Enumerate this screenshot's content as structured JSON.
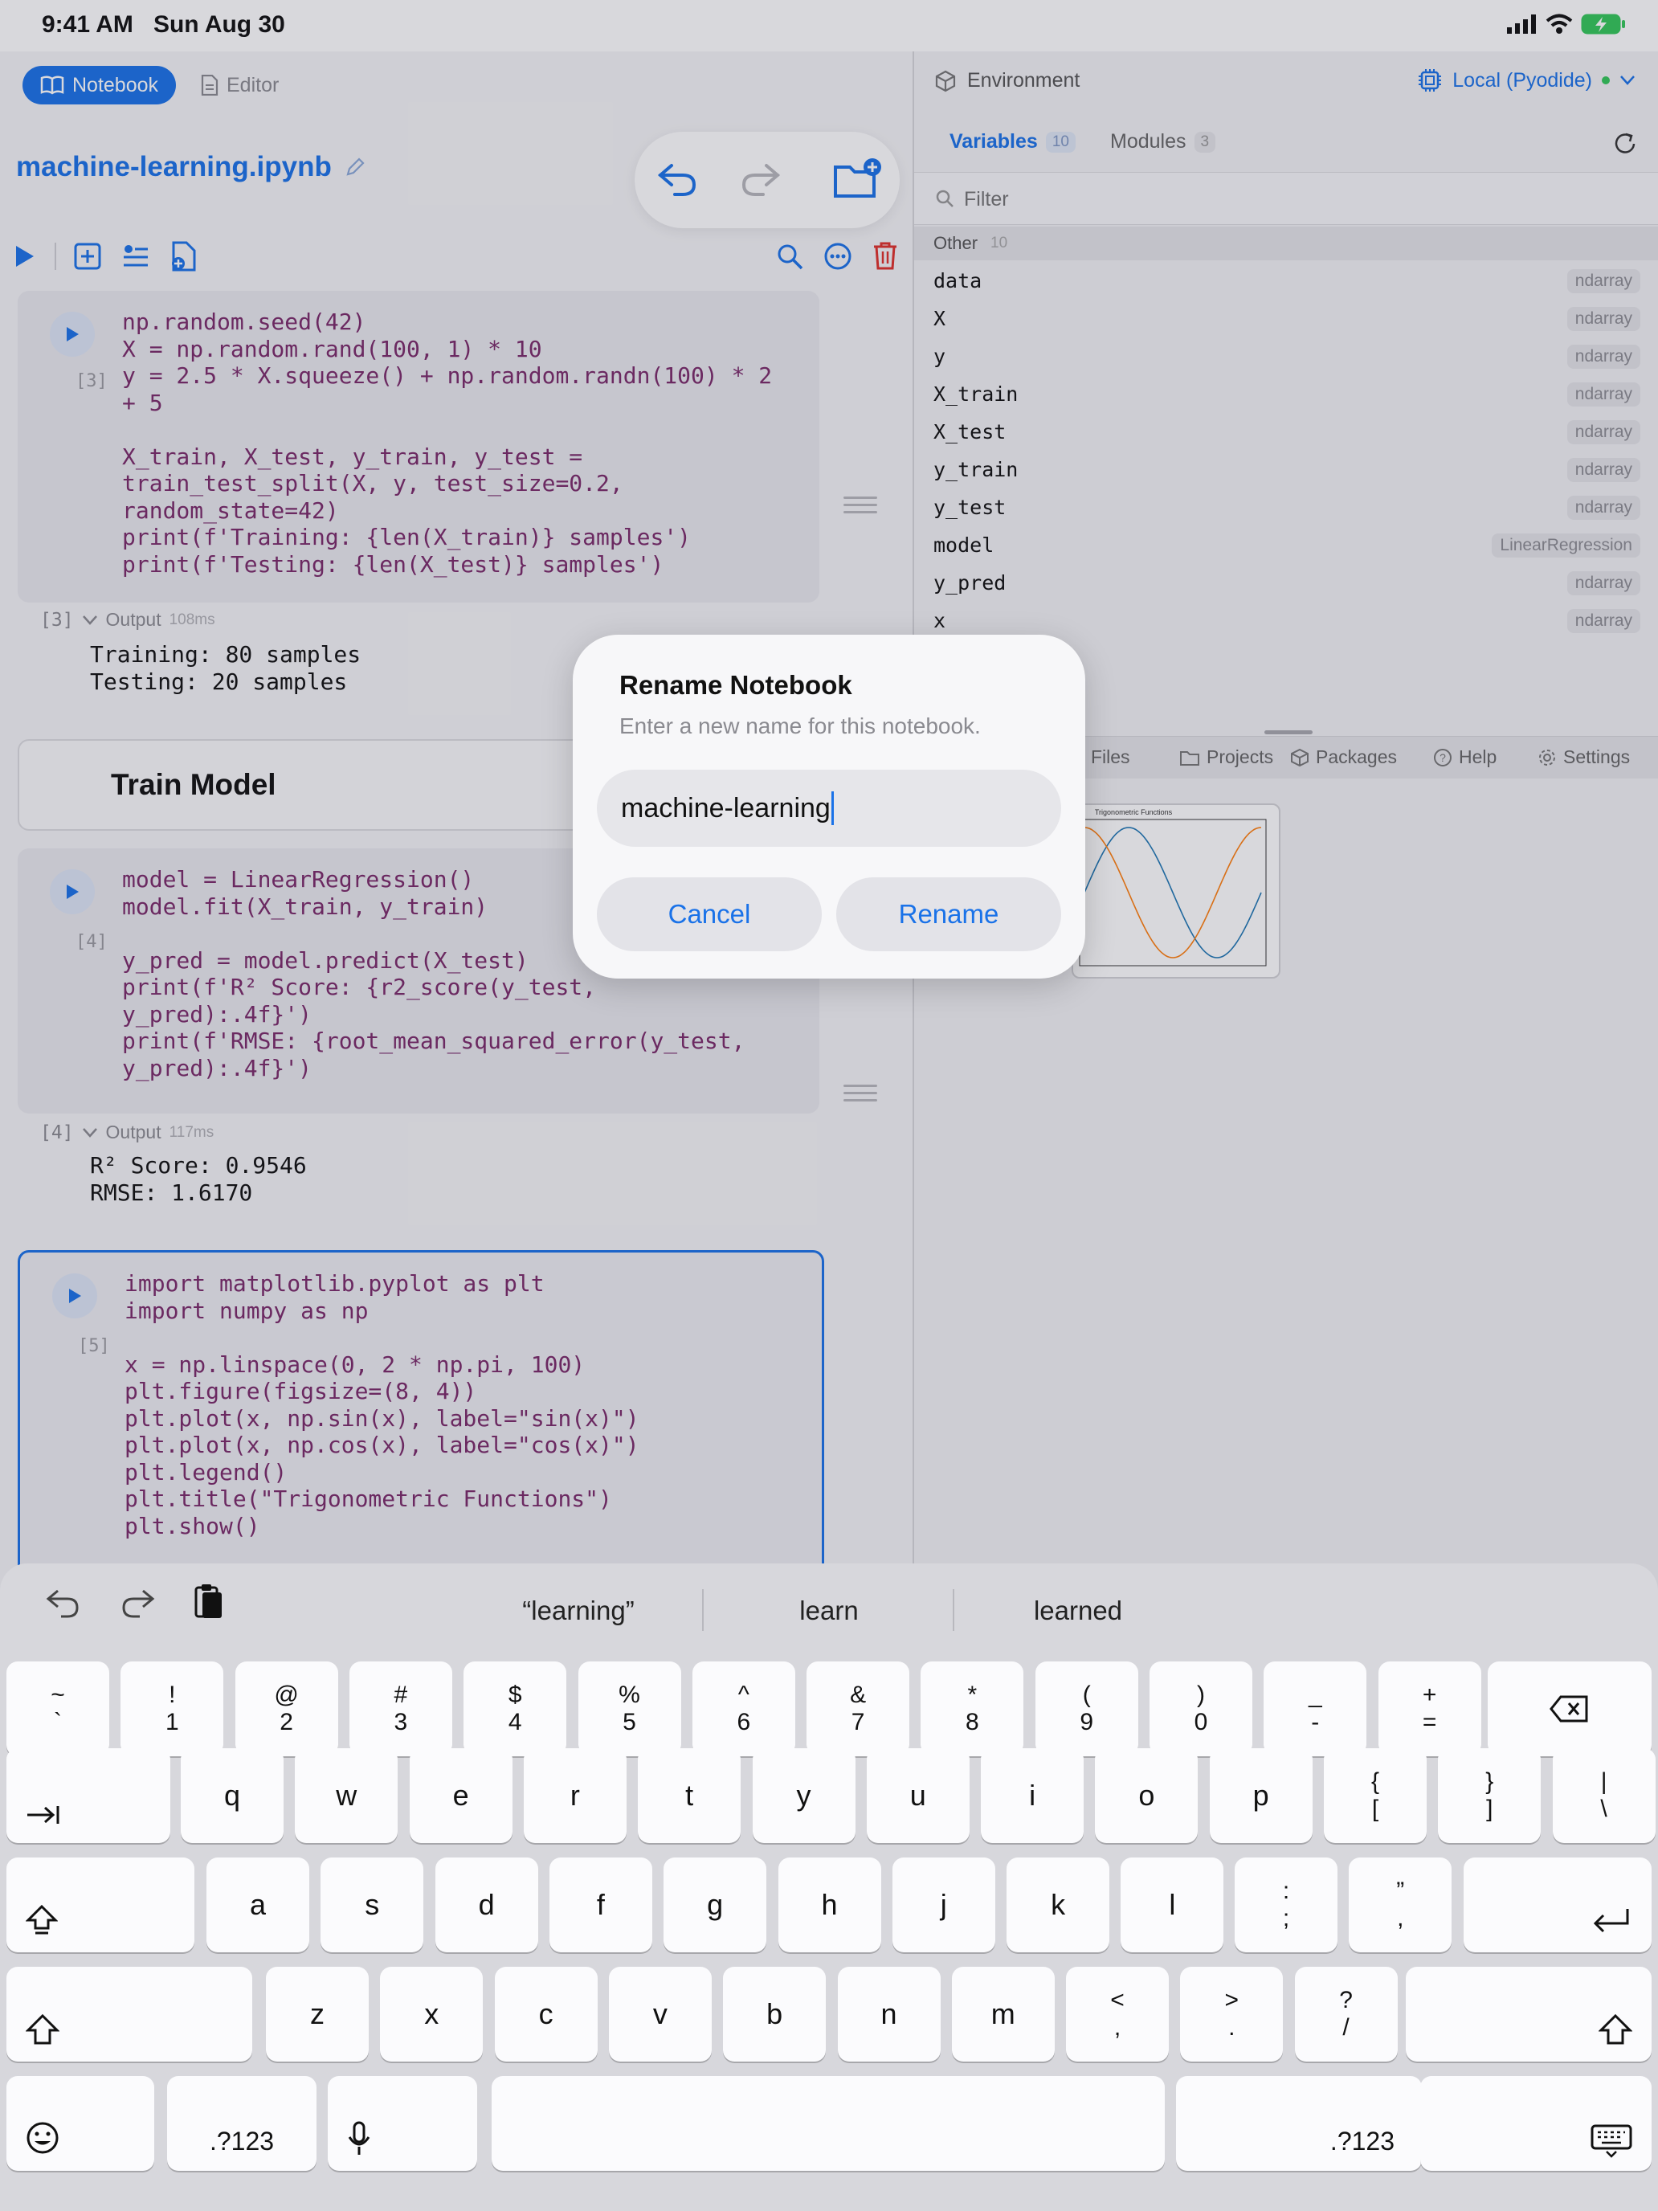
{
  "status_bar": {
    "time": "9:41 AM",
    "date": "Sun Aug 30"
  },
  "toolbar": {
    "notebook_tab": "Notebook",
    "editor_tab": "Editor",
    "filename": "machine-learning.ipynb"
  },
  "cells": [
    {
      "exec_label": "[3]",
      "code": "np.random.seed(42)\nX = np.random.rand(100, 1) * 10\ny = 2.5 * X.squeeze() + np.random.randn(100) * 2\n+ 5\n\nX_train, X_test, y_train, y_test =\ntrain_test_split(X, y, test_size=0.2,\nrandom_state=42)\nprint(f'Training: {len(X_train)} samples')\nprint(f'Testing: {len(X_test)} samples')",
      "output_label": "[3]",
      "output_title": "Output",
      "output_time": "108ms",
      "output": "Training: 80 samples\nTesting: 20 samples"
    },
    {
      "exec_label": "[4]",
      "code": "model = LinearRegression()\nmodel.fit(X_train, y_train)\n\ny_pred = model.predict(X_test)\nprint(f'R² Score: {r2_score(y_test,\ny_pred):.4f}')\nprint(f'RMSE: {root_mean_squared_error(y_test,\ny_pred):.4f}')",
      "output_label": "[4]",
      "output_title": "Output",
      "output_time": "117ms",
      "output": "R² Score: 0.9546\nRMSE: 1.6170"
    },
    {
      "exec_label": "[5]",
      "code": "import matplotlib.pyplot as plt\nimport numpy as np\n\nx = np.linspace(0, 2 * np.pi, 100)\nplt.figure(figsize=(8, 4))\nplt.plot(x, np.sin(x), label=\"sin(x)\")\nplt.plot(x, np.cos(x), label=\"cos(x)\")\nplt.legend()\nplt.title(\"Trigonometric Functions\")\nplt.show()"
    }
  ],
  "markdown_heading": "Train Model",
  "environment": {
    "title": "Environment",
    "runtime": "Local (Pyodide)",
    "tabs": {
      "variables": "Variables",
      "variables_count": "10",
      "modules": "Modules",
      "modules_count": "3"
    },
    "filter_placeholder": "Filter",
    "group_label": "Other",
    "group_count": "10",
    "variables": [
      {
        "name": "data",
        "type": "ndarray"
      },
      {
        "name": "X",
        "type": "ndarray"
      },
      {
        "name": "y",
        "type": "ndarray"
      },
      {
        "name": "X_train",
        "type": "ndarray"
      },
      {
        "name": "X_test",
        "type": "ndarray"
      },
      {
        "name": "y_train",
        "type": "ndarray"
      },
      {
        "name": "y_test",
        "type": "ndarray"
      },
      {
        "name": "model",
        "type": "LinearRegression"
      },
      {
        "name": "y_pred",
        "type": "ndarray"
      },
      {
        "name": "x",
        "type": "ndarray"
      }
    ],
    "bottom_tabs": {
      "files": "Files",
      "projects": "Projects",
      "packages": "Packages",
      "help": "Help",
      "settings": "Settings"
    },
    "plot_title": "Trigonometric Functions"
  },
  "dialog": {
    "title": "Rename Notebook",
    "message": "Enter a new name for this notebook.",
    "input_value": "machine-learning",
    "cancel": "Cancel",
    "confirm": "Rename"
  },
  "keyboard": {
    "suggestions": [
      "“learning”",
      "learn",
      "learned"
    ],
    "row1": [
      [
        "~",
        "`"
      ],
      [
        "!",
        "1"
      ],
      [
        "@",
        "2"
      ],
      [
        "#",
        "3"
      ],
      [
        "$",
        "4"
      ],
      [
        "%",
        "5"
      ],
      [
        "^",
        "6"
      ],
      [
        "&",
        "7"
      ],
      [
        "*",
        "8"
      ],
      [
        "(",
        "9"
      ],
      [
        ")",
        "0"
      ],
      [
        "_",
        "-"
      ],
      [
        "+",
        "="
      ]
    ],
    "row2": [
      "q",
      "w",
      "e",
      "r",
      "t",
      "y",
      "u",
      "i",
      "o",
      "p"
    ],
    "row2_extra": [
      [
        "{",
        "["
      ],
      [
        "}",
        "]"
      ],
      [
        "|",
        "\\"
      ]
    ],
    "row3": [
      "a",
      "s",
      "d",
      "f",
      "g",
      "h",
      "j",
      "k",
      "l"
    ],
    "row3_extra": [
      [
        ":",
        ";"
      ],
      [
        "”",
        ","
      ]
    ],
    "row4": [
      "z",
      "x",
      "c",
      "v",
      "b",
      "n",
      "m"
    ],
    "row4_extra": [
      [
        "<",
        ","
      ],
      [
        ">",
        "."
      ],
      [
        "?",
        "/"
      ]
    ],
    "numbers_key": ".?123"
  },
  "colors": {
    "accent": "#1a72e8",
    "delete": "#e0302a",
    "runtime_dot": "#34c759"
  }
}
